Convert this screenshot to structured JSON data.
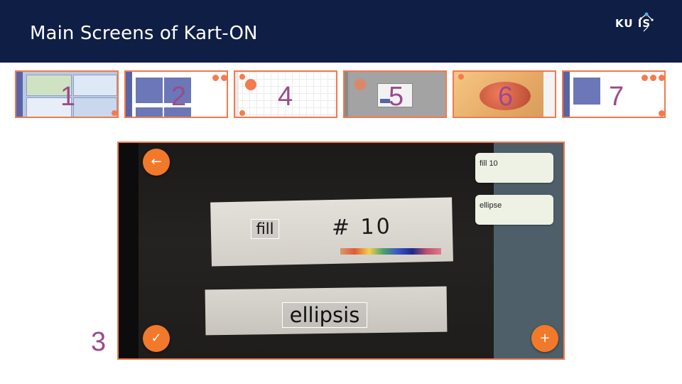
{
  "slide": {
    "title": "Main Screens of Kart-ON",
    "logo_text": "KU  IS"
  },
  "thumbnails": [
    {
      "number": "1"
    },
    {
      "number": "2"
    },
    {
      "number": "4"
    },
    {
      "number": "5"
    },
    {
      "number": "6"
    },
    {
      "number": "7"
    }
  ],
  "main_screen": {
    "number": "3",
    "detected_words": [
      "fill",
      "ellipsis"
    ],
    "handwritten_text": "# 10",
    "cards": [
      "fill 10",
      "ellipse"
    ],
    "icons": {
      "back": "arrow-left-icon",
      "confirm": "check-icon",
      "add": "plus-icon"
    }
  },
  "colors": {
    "header_bg": "#0f1e44",
    "accent_orange": "#f2792a",
    "thumb_border": "#f07a4e",
    "number_purple": "#9b4a8c",
    "panel_bg": "#4e5f69",
    "card_bg": "#eef2e4"
  }
}
